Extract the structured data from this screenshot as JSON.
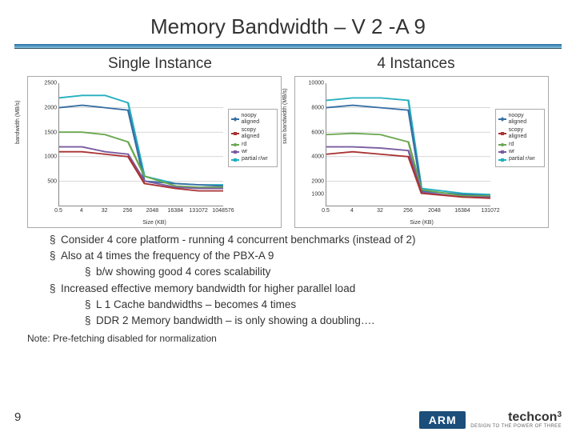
{
  "slide": {
    "title": "Memory Bandwidth – V 2 -A 9",
    "chart_left_title": "Single Instance",
    "chart_right_title": "4 Instances",
    "bullets": [
      "Consider 4 core platform - running 4 concurrent benchmarks (instead of 2)",
      "Also at 4 times the frequency of the PBX-A 9"
    ],
    "sub_bullets_1": [
      "b/w showing good 4 cores scalability"
    ],
    "bullets2": [
      "Increased effective memory bandwidth for higher parallel load"
    ],
    "sub_bullets_2": [
      "L 1 Cache bandwidths – becomes 4 times",
      "DDR 2 Memory bandwidth – is only showing a doubling…."
    ],
    "note": "Note: Pre-fetching disabled for normalization",
    "page_number": "9",
    "brand_main": "ARM",
    "brand_tcon": "techcon",
    "brand_sup": "3",
    "brand_sub": "DESIGN TO THE POWER OF THREE"
  },
  "legend": {
    "items": [
      "noopy aligned",
      "scopy aligned",
      "rd",
      "wr",
      "partial r/wr"
    ]
  },
  "axes": {
    "left": {
      "ylabel": "bandwidth (MB/s)",
      "xlabel": "Size (KB)",
      "yticks": [
        "2500",
        "2000",
        "1500",
        "1000",
        "500"
      ],
      "xticks": [
        "0.5",
        "4",
        "32",
        "256",
        "2048",
        "16384",
        "131072",
        "1048576"
      ]
    },
    "right": {
      "ylabel": "sum bandwidth (MB/s)",
      "xlabel": "Size (KB)",
      "yticks": [
        "10000",
        "8000",
        "6000",
        "4000",
        "2000",
        "1000"
      ],
      "xticks": [
        "0.5",
        "4",
        "32",
        "256",
        "2048",
        "16384",
        "131072"
      ]
    }
  },
  "chart_data": [
    {
      "type": "line",
      "title": "Single Instance",
      "xlabel": "Size (KB)",
      "ylabel": "bandwidth (MB/s)",
      "ylim": [
        0,
        2500
      ],
      "x": [
        0.5,
        4,
        32,
        256,
        2048,
        16384,
        131072,
        1048576
      ],
      "series": [
        {
          "name": "noopy aligned",
          "values": [
            2000,
            2050,
            2000,
            1950,
            500,
            450,
            420,
            400
          ]
        },
        {
          "name": "scopy aligned",
          "values": [
            1100,
            1100,
            1050,
            1000,
            450,
            350,
            300,
            300
          ]
        },
        {
          "name": "rd",
          "values": [
            1500,
            1500,
            1450,
            1300,
            600,
            400,
            380,
            380
          ]
        },
        {
          "name": "wr",
          "values": [
            1200,
            1200,
            1100,
            1050,
            500,
            380,
            350,
            350
          ]
        },
        {
          "name": "partial r/wr",
          "values": [
            2200,
            2250,
            2250,
            2100,
            600,
            450,
            420,
            420
          ]
        }
      ]
    },
    {
      "type": "line",
      "title": "4 Instances",
      "xlabel": "Size (KB)",
      "ylabel": "sum bandwidth (MB/s)",
      "ylim": [
        0,
        10000
      ],
      "x": [
        0.5,
        4,
        32,
        256,
        2048,
        16384,
        131072
      ],
      "series": [
        {
          "name": "noopy aligned",
          "values": [
            8000,
            8200,
            8000,
            7800,
            1200,
            900,
            850
          ]
        },
        {
          "name": "scopy aligned",
          "values": [
            4200,
            4400,
            4200,
            4000,
            1000,
            700,
            650
          ]
        },
        {
          "name": "rd",
          "values": [
            5800,
            5900,
            5800,
            5200,
            1300,
            800,
            780
          ]
        },
        {
          "name": "wr",
          "values": [
            4800,
            4800,
            4700,
            4500,
            1100,
            750,
            700
          ]
        },
        {
          "name": "partial r/wr",
          "values": [
            8600,
            8800,
            8800,
            8600,
            1400,
            950,
            900
          ]
        }
      ]
    }
  ]
}
